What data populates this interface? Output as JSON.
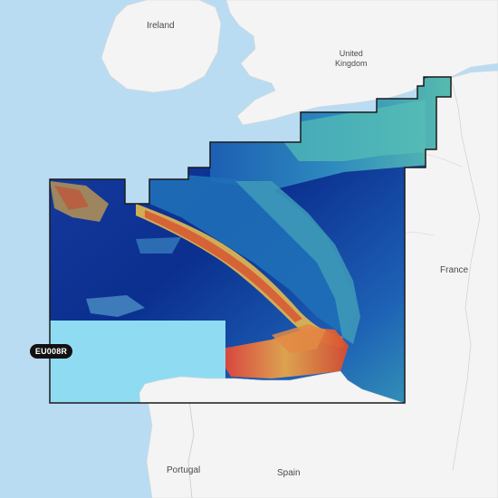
{
  "map": {
    "labels": {
      "ireland": "Ireland",
      "united_kingdom": "United\nKingdom",
      "france": "France",
      "portugal": "Portugal",
      "spain": "Spain"
    },
    "chart_code": "EU008R",
    "colors": {
      "sea": "#b9dcf2",
      "land": "#f4f4f4",
      "border": "#c9c9c9",
      "coverage_outline": "#1b1b1b",
      "inset_panel": "#8fdcf2",
      "deep_water": "#0b2f8f",
      "mid_water": "#1d61b5",
      "shallow_water": "#38a5b5",
      "shelf_edge": "#e7c14e",
      "relief_red": "#d84a2f"
    }
  }
}
